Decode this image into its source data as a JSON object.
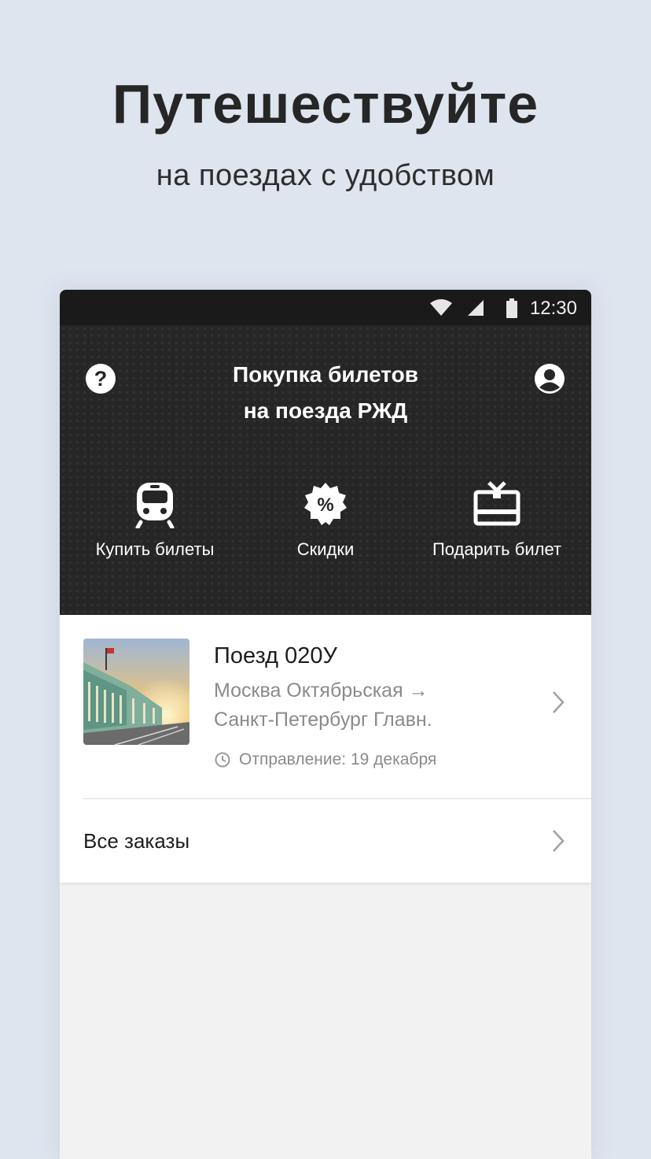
{
  "promo": {
    "title": "Путешествуйте",
    "subtitle": "на поездах с удобством"
  },
  "status_bar": {
    "time": "12:30",
    "icons": [
      "wifi-icon",
      "signal-icon",
      "battery-icon"
    ]
  },
  "header": {
    "title_line1": "Покупка билетов",
    "title_line2": "на поезда РЖД",
    "left_icon": "help-icon",
    "right_icon": "account-icon"
  },
  "features": [
    {
      "label": "Купить билеты",
      "icon": "train-icon"
    },
    {
      "label": "Скидки",
      "icon": "discount-icon"
    },
    {
      "label": "Подарить билет",
      "icon": "gift-icon"
    }
  ],
  "trip": {
    "title": "Поезд 020У",
    "route_from": "Москва Октябрьская →",
    "route_to": "Санкт-Петербург Главн.",
    "departure": "Отправление: 19 декабря"
  },
  "orders": {
    "label": "Все заказы"
  },
  "colors": {
    "page_bg": "#dfe5ef",
    "header_bg": "#262626",
    "status_bg": "#1a1a1a",
    "secondary_text": "#8a8a8a"
  }
}
